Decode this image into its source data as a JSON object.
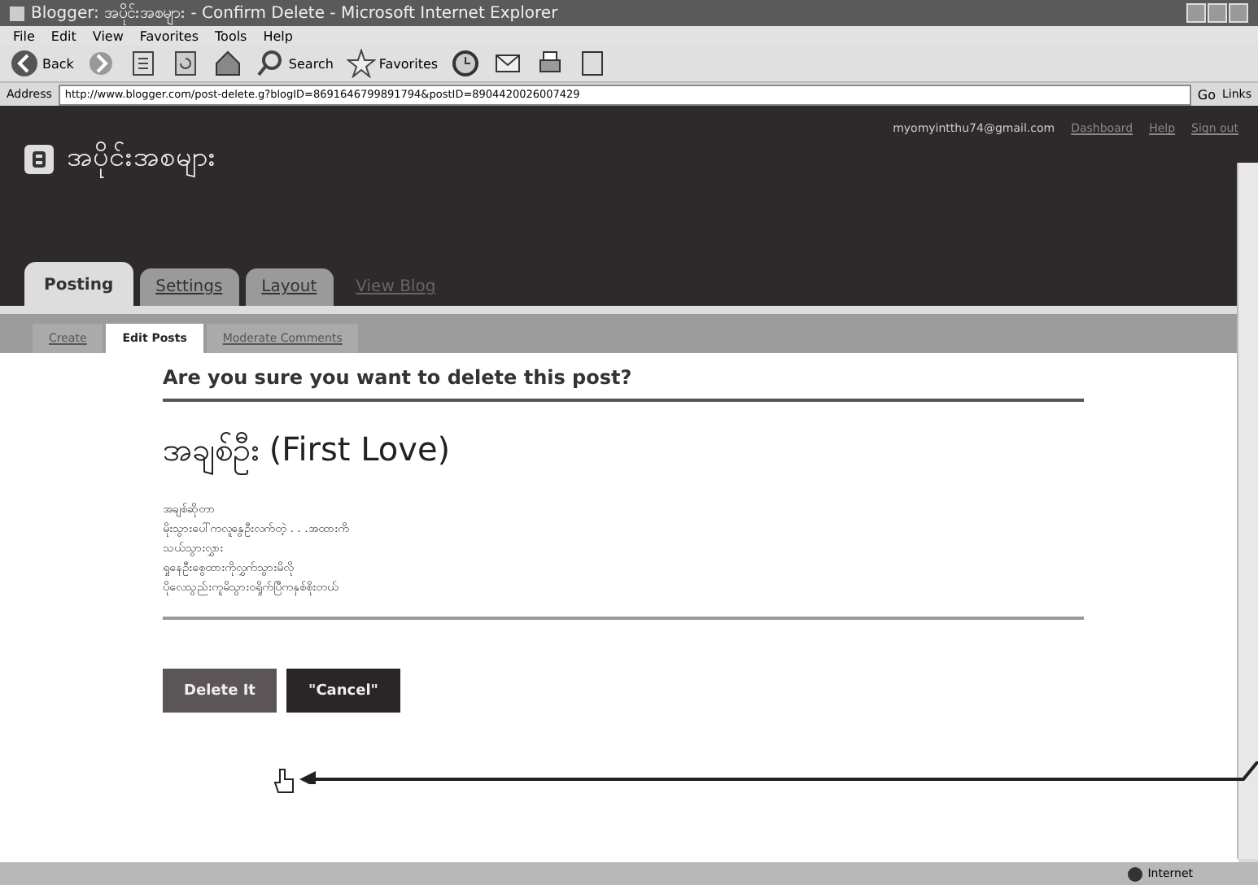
{
  "window": {
    "title": "Blogger: အပိုင်းအစများ - Confirm Delete - Microsoft Internet Explorer"
  },
  "menu": [
    "File",
    "Edit",
    "View",
    "Favorites",
    "Tools",
    "Help"
  ],
  "toolbar": [
    {
      "kind": "back",
      "label": "Back"
    },
    {
      "kind": "forward"
    },
    {
      "kind": "stop"
    },
    {
      "kind": "refresh"
    },
    {
      "kind": "home"
    },
    {
      "kind": "search",
      "label": "Search"
    },
    {
      "kind": "favorites",
      "label": "Favorites"
    },
    {
      "kind": "history"
    },
    {
      "kind": "mail"
    },
    {
      "kind": "print"
    },
    {
      "kind": "edit"
    }
  ],
  "address": {
    "label": "Address",
    "value": "http://www.blogger.com/post-delete.g?blogID=8691646799891794&postID=8904420026007429",
    "go": "Go",
    "links": "Links"
  },
  "blog": {
    "title": "အပိုင်းအစများ",
    "email": "myomyintthu74@gmail.com",
    "links": [
      "Dashboard",
      "Help",
      "Sign out"
    ]
  },
  "tabs": [
    {
      "label": "Posting",
      "selected": true
    },
    {
      "label": "Settings",
      "selected": false
    },
    {
      "label": "Layout",
      "selected": false
    },
    {
      "label": "View Blog",
      "kind": "link",
      "selected": false
    }
  ],
  "subtabs": [
    {
      "label": "Create",
      "selected": false
    },
    {
      "label": "Edit Posts",
      "selected": true
    },
    {
      "label": "Moderate Comments",
      "selected": false
    }
  ],
  "question": "Are you sure you want to delete this post?",
  "post": {
    "title": "အချစ်ဦး (First Love)",
    "lines": [
      "အချစ်ဆိုတာ",
      "မိုးသွားပေါ်ကလူနွေဦးလက်တဲ့ . . .အထားကိ",
      "သယ်သွားလွှား",
      "ရှုနေဦးစွေထားကိုလွှက်သွားမိလို",
      "ပိုလေသွည်းကူမိသွားဝရှိုက်ပြီကနှစ်စိုးတယ်"
    ]
  },
  "buttons": [
    {
      "label": "Delete It",
      "selected": true
    },
    {
      "label": "\"Cancel\"",
      "selected": false
    }
  ],
  "status": {
    "zone": "Internet"
  }
}
